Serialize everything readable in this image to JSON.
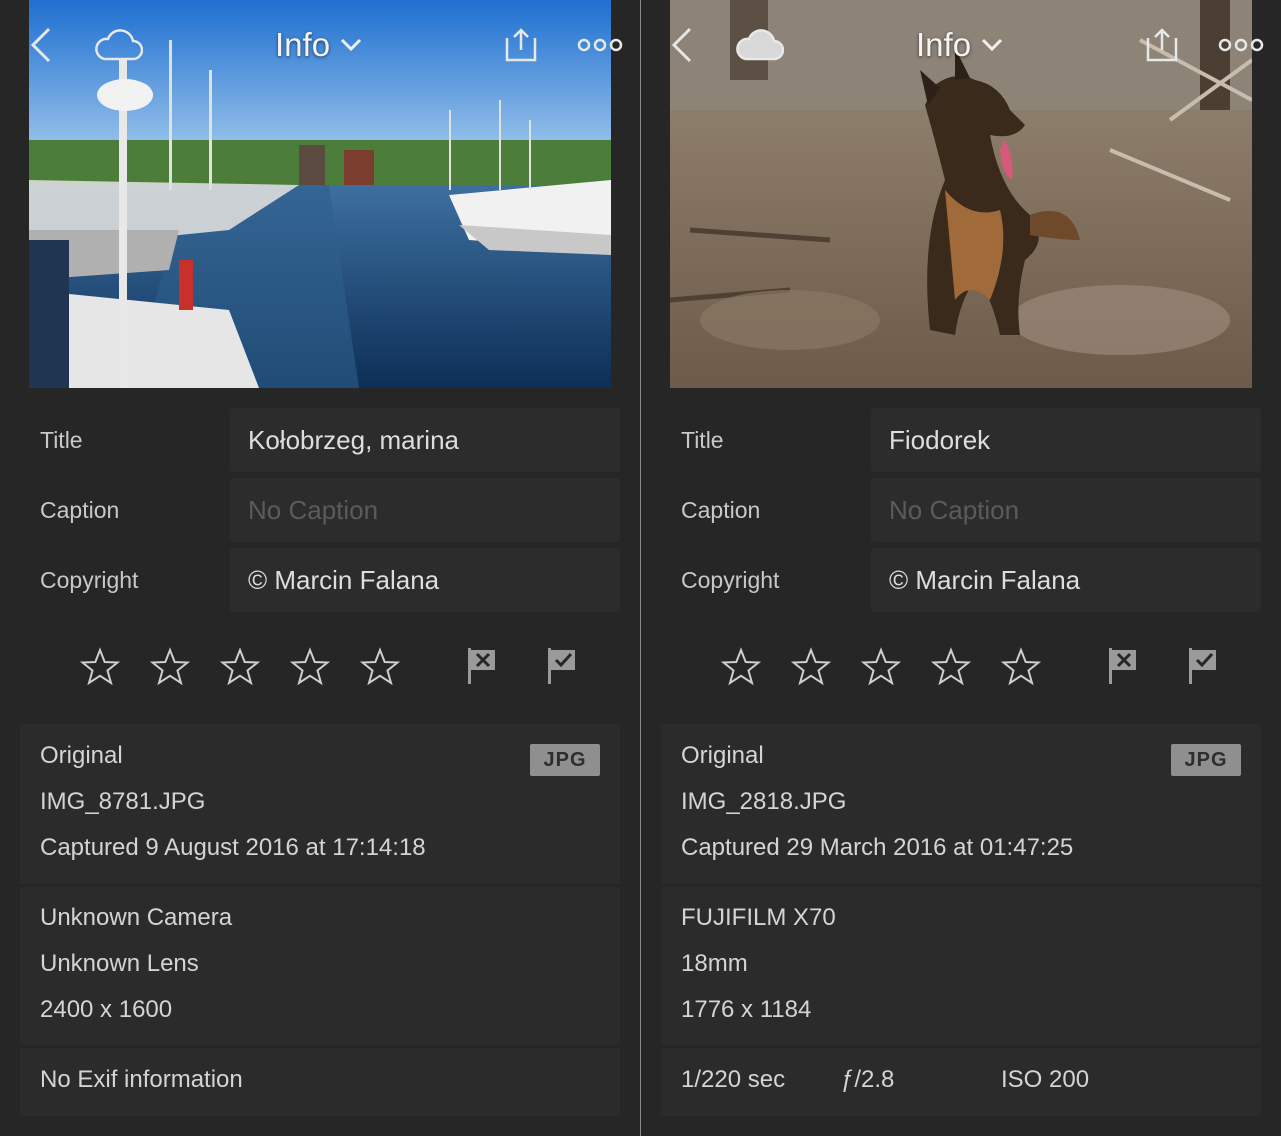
{
  "panels": [
    {
      "header": {
        "title": "Info",
        "icons": [
          "back-chevron-icon",
          "cloud-icon",
          "share-icon",
          "more-dots-icon"
        ]
      },
      "photo_subject": "marina",
      "fields": {
        "title_label": "Title",
        "title_value": "Kołobrzeg, marina",
        "caption_label": "Caption",
        "caption_placeholder": "No Caption",
        "copyright_label": "Copyright",
        "copyright_value": "© Marcin Falana"
      },
      "rating": {
        "stars": 0,
        "max": 5
      },
      "original": {
        "heading": "Original",
        "filename": "IMG_8781.JPG",
        "captured": "Captured 9 August 2016 at 17:14:18",
        "format_badge": "JPG"
      },
      "camera": {
        "camera": "Unknown Camera",
        "lens": "Unknown Lens",
        "dimensions": "2400 x 1600"
      },
      "exif": {
        "text": "No Exif information"
      }
    },
    {
      "header": {
        "title": "Info",
        "icons": [
          "back-chevron-icon",
          "cloud-icon",
          "share-icon",
          "more-dots-icon"
        ]
      },
      "photo_subject": "dog",
      "fields": {
        "title_label": "Title",
        "title_value": "Fiodorek",
        "caption_label": "Caption",
        "caption_placeholder": "No Caption",
        "copyright_label": "Copyright",
        "copyright_value": "© Marcin Falana"
      },
      "rating": {
        "stars": 0,
        "max": 5
      },
      "original": {
        "heading": "Original",
        "filename": "IMG_2818.JPG",
        "captured": "Captured 29 March 2016 at 01:47:25",
        "format_badge": "JPG"
      },
      "camera": {
        "camera": "FUJIFILM X70",
        "lens": "18mm",
        "dimensions": "1776 x 1184"
      },
      "exif": {
        "shutter": "1/220 sec",
        "aperture": "ƒ/2.8",
        "iso": "ISO 200"
      }
    }
  ],
  "colors": {
    "background": "#262626",
    "field_bg": "#2c2c2c",
    "card_bg": "#2b2b2b",
    "badge_bg": "#8f8f8f",
    "divider": "#8a8a8a"
  }
}
